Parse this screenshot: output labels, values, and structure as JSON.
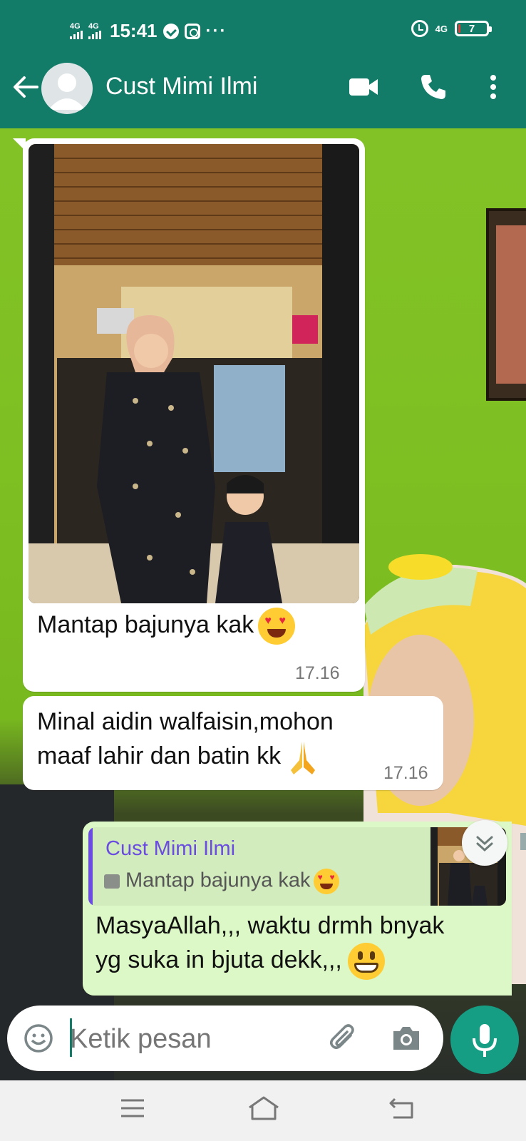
{
  "status_bar": {
    "net1": "4G",
    "net2": "4G",
    "time": "15:41",
    "more": "···",
    "net3": "4G",
    "battery_level": "7",
    "battery_fraction": 0.07
  },
  "header": {
    "contact_name": "Cust Mimi Ilmi",
    "back_icon": "arrow-left-icon",
    "video_icon": "video-call-icon",
    "call_icon": "phone-icon",
    "menu_icon": "more-vertical-icon"
  },
  "messages": [
    {
      "direction": "incoming",
      "type": "image",
      "caption": "Mantap bajunya kak",
      "emoji": "smiling-face-with-heart-eyes",
      "time": "17.16"
    },
    {
      "direction": "incoming",
      "type": "text",
      "line1": "Minal aidin walfaisin,mohon",
      "line2": "maaf lahir dan batin kk",
      "emoji": "folded-hands",
      "time": "17.16"
    },
    {
      "direction": "outgoing",
      "type": "reply",
      "quote_name": "Cust Mimi Ilmi",
      "quote_text": "Mantap bajunya kak",
      "quote_emoji": "smiling-face-with-heart-eyes",
      "line1": "MasyaAllah,,,  waktu drmh bnyak",
      "line2": "yg suka in bjuta dekk,,,",
      "emoji": "grinning-face"
    }
  ],
  "composer": {
    "placeholder": "Ketik pesan",
    "emoji_icon": "emoji-icon",
    "attach_icon": "paperclip-icon",
    "camera_icon": "camera-icon",
    "mic_icon": "microphone-icon"
  },
  "colors": {
    "header": "#127c68",
    "accent": "#169e84",
    "outgoing_bubble": "#dcf8c6",
    "incoming_bubble": "#ffffff",
    "quote_name": "#6b4ce0"
  }
}
